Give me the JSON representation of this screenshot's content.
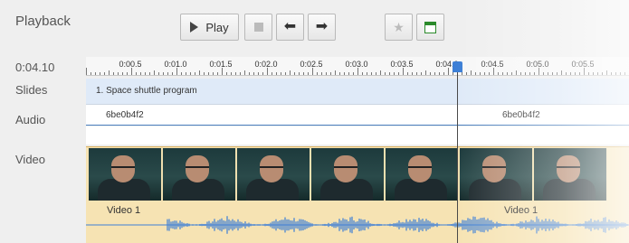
{
  "panel_title": "Playback",
  "toolbar": {
    "play_label": "Play",
    "icons": [
      "play-icon",
      "stop-icon",
      "arrow-left-icon",
      "arrow-right-icon",
      "star-icon",
      "panel-icon"
    ]
  },
  "time_readout": "0:04.10",
  "tracks": {
    "slides_label": "Slides",
    "audio_label": "Audio",
    "video_label": "Video"
  },
  "ruler": {
    "ticks": [
      "0:00.5",
      "0:01.0",
      "0:01.5",
      "0:02.0",
      "0:02.5",
      "0:03.0",
      "0:03.5",
      "0:04.0",
      "0:04.5",
      "0:05.0",
      "0:05.5"
    ]
  },
  "slides": [
    {
      "title": "1. Space shuttle program"
    }
  ],
  "audio": [
    {
      "id": "6be0b4f2"
    },
    {
      "id": "6be0b4f2"
    }
  ],
  "video": [
    {
      "title": "Video 1"
    },
    {
      "title": "Video 1"
    }
  ],
  "colors": {
    "playhead": "#3d7fd6",
    "slides_track": "#dfeaf8",
    "video_track": "#f6e3b3",
    "waveform": "#3d7fd6"
  }
}
